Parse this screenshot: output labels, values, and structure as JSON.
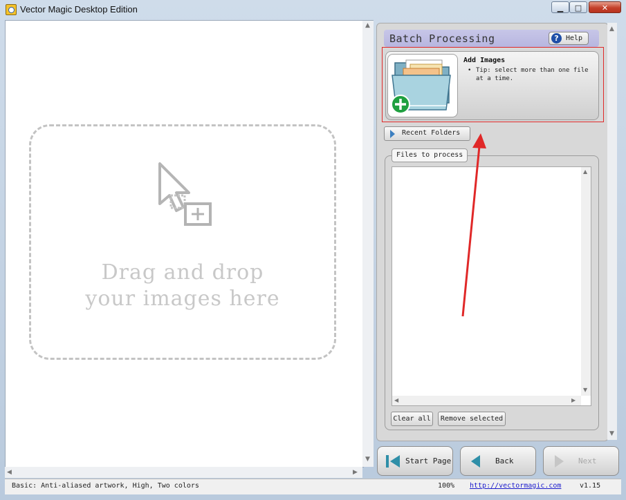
{
  "window": {
    "title": "Vector Magic Desktop Edition",
    "controls": {
      "minimize": "▁",
      "maximize": "□",
      "close": "✕"
    }
  },
  "canvas": {
    "drop_line1": "Drag and drop",
    "drop_line2": "your images here"
  },
  "batch": {
    "title": "Batch Processing",
    "help_label": "Help",
    "help_icon": "?",
    "add_images": {
      "title": "Add Images",
      "tip": "Tip: select more than one file at a time."
    },
    "recent_folders_label": "Recent Folders",
    "files_to_process_label": "Files to process",
    "clear_all_label": "Clear all",
    "remove_selected_label": "Remove selected"
  },
  "nav": {
    "start_page": "Start Page",
    "back": "Back",
    "next": "Next"
  },
  "status": {
    "settings": "Basic: Anti-aliased artwork, High, Two colors",
    "zoom": "100%",
    "link": "http://vectormagic.com",
    "version": "v1.15"
  },
  "colors": {
    "header_bg": "#bdbce3",
    "annotation_red": "#e02828",
    "add_plus_green": "#1fa040"
  }
}
